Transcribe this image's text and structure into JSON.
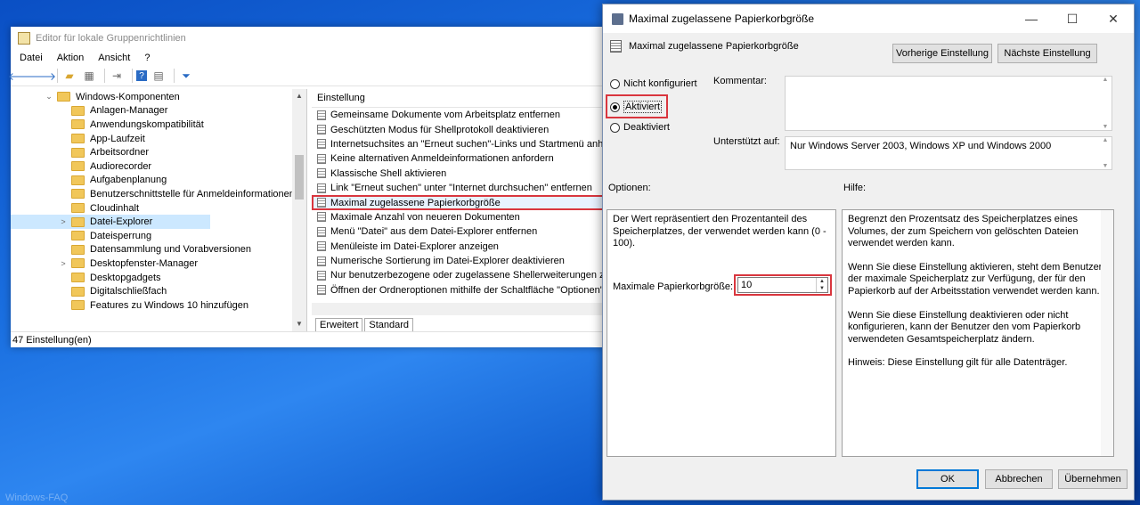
{
  "watermark": "Windows-FAQ",
  "gpedit": {
    "title": "Editor für lokale Gruppenrichtlinien",
    "menu": [
      "Datei",
      "Aktion",
      "Ansicht",
      "?"
    ],
    "toolbar": [
      "back-arrow-icon",
      "forward-arrow-icon",
      "folder-up-icon",
      "show-tree-icon",
      "export-icon",
      "help-icon",
      "properties-icon",
      "filter-icon"
    ],
    "tree": [
      {
        "label": "Windows-Komponenten",
        "depth": 0,
        "caret": "⌄"
      },
      {
        "label": "Anlagen-Manager",
        "depth": 1,
        "caret": ""
      },
      {
        "label": "Anwendungskompatibilität",
        "depth": 1,
        "caret": ""
      },
      {
        "label": "App-Laufzeit",
        "depth": 1,
        "caret": ""
      },
      {
        "label": "Arbeitsordner",
        "depth": 1,
        "caret": ""
      },
      {
        "label": "Audiorecorder",
        "depth": 1,
        "caret": ""
      },
      {
        "label": "Aufgabenplanung",
        "depth": 1,
        "caret": ""
      },
      {
        "label": "Benutzerschnittstelle für Anmeldeinformationen",
        "depth": 1,
        "caret": ""
      },
      {
        "label": "Cloudinhalt",
        "depth": 1,
        "caret": ""
      },
      {
        "label": "Datei-Explorer",
        "depth": 1,
        "caret": ">",
        "selected": true
      },
      {
        "label": "Dateisperrung",
        "depth": 1,
        "caret": ""
      },
      {
        "label": "Datensammlung und Vorabversionen",
        "depth": 1,
        "caret": ""
      },
      {
        "label": "Desktopfenster-Manager",
        "depth": 1,
        "caret": ">"
      },
      {
        "label": "Desktopgadgets",
        "depth": 1,
        "caret": ""
      },
      {
        "label": "Digitalschließfach",
        "depth": 1,
        "caret": ""
      },
      {
        "label": "Features zu Windows 10 hinzufügen",
        "depth": 1,
        "caret": ""
      }
    ],
    "list_header": "Einstellung",
    "list": [
      "Gemeinsame Dokumente vom Arbeitsplatz entfernen",
      "Geschützten Modus für Shellprotokoll deaktivieren",
      "Internetsuchsites an \"Erneut suchen\"-Links und Startmenü anheften",
      "Keine alternativen Anmeldeinformationen anfordern",
      "Klassische Shell aktivieren",
      "Link \"Erneut suchen\" unter \"Internet durchsuchen\" entfernen",
      "Maximal zugelassene Papierkorbgröße",
      "Maximale Anzahl von neueren Dokumenten",
      "Menü \"Datei\" aus dem Datei-Explorer entfernen",
      "Menüleiste im Datei-Explorer anzeigen",
      "Numerische Sortierung im Datei-Explorer deaktivieren",
      "Nur benutzerbezogene oder zugelassene Shellerweiterungen zulasse",
      "Öffnen der Ordneroptionen mithilfe der Schaltfläche \"Optionen\" auf"
    ],
    "highlighted_index": 6,
    "tabs": [
      "Erweitert",
      "Standard"
    ],
    "status": "47 Einstellung(en)"
  },
  "dialog": {
    "title": "Maximal zugelassene Papierkorbgröße",
    "policy_name": "Maximal zugelassene Papierkorbgröße",
    "prev_button": "Vorherige Einstellung",
    "next_button": "Nächste Einstellung",
    "radio_not_configured": "Nicht konfiguriert",
    "radio_enabled": "Aktiviert",
    "radio_disabled": "Deaktiviert",
    "selected_radio": "Aktiviert",
    "comment_label": "Kommentar:",
    "supported_label": "Unterstützt auf:",
    "supported_value": "Nur Windows Server 2003, Windows XP und Windows 2000",
    "options_label": "Optionen:",
    "help_label": "Hilfe:",
    "options_text": "Der Wert repräsentiert den Prozentanteil des Speicherplatzes, der verwendet werden kann (0 - 100).",
    "max_size_label": "Maximale Papierkorbgröße:",
    "max_size_value": "10",
    "help_p1": "Begrenzt den Prozentsatz des Speicherplatzes eines Volumes, der zum Speichern von gelöschten Dateien verwendet werden kann.",
    "help_p2": "Wenn Sie diese Einstellung aktivieren, steht dem Benutzer der maximale Speicherplatz zur Verfügung, der für den Papierkorb auf der Arbeitsstation verwendet werden kann.",
    "help_p3": "Wenn Sie diese Einstellung deaktivieren oder nicht konfigurieren, kann der Benutzer den vom Papierkorb verwendeten Gesamtspeicherplatz ändern.",
    "help_p4": "Hinweis: Diese Einstellung gilt für alle Datenträger.",
    "ok": "OK",
    "cancel": "Abbrechen",
    "apply": "Übernehmen"
  }
}
